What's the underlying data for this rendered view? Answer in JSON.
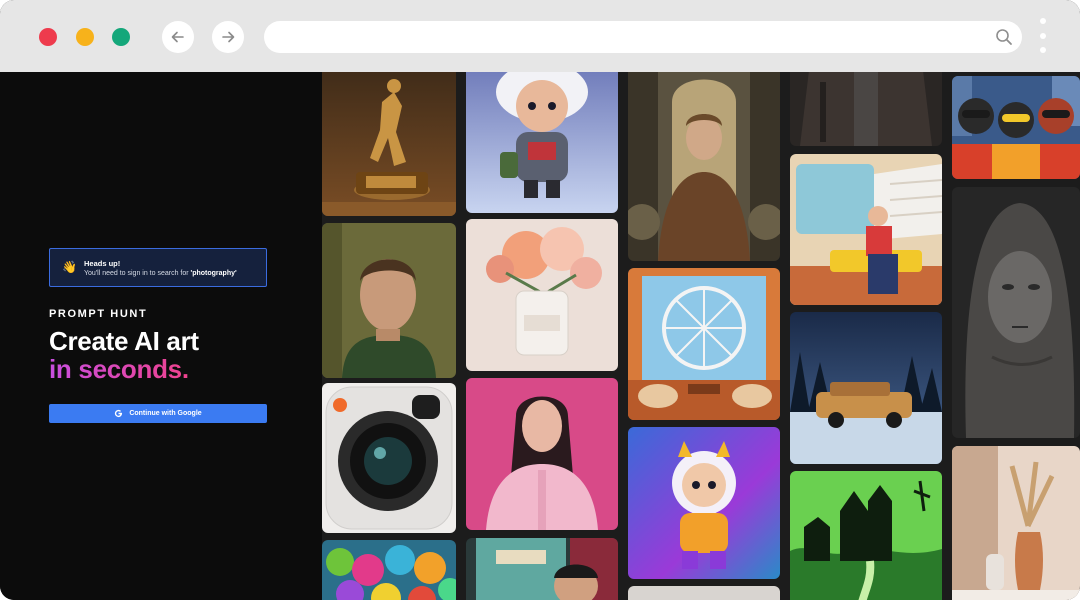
{
  "browser": {
    "url": "",
    "url_placeholder": ""
  },
  "alert": {
    "emoji": "👋",
    "title": "Heads up!",
    "body_prefix": "You'll need to sign in to search for ",
    "body_term": "'photography'"
  },
  "hero": {
    "brand": "PROMPT HUNT",
    "headline_line1": "Create AI art",
    "headline_line2": "in seconds."
  },
  "auth": {
    "google_label": "Continue with Google"
  },
  "colors": {
    "chrome": "#e6e6e6",
    "panel_bg": "#0c0c0c",
    "accent_blue": "#3b7bf2",
    "gradient_start": "#c84fe0",
    "gradient_end": "#f0428d",
    "dot_red": "#ee3b4d",
    "dot_yellow": "#f7b21b",
    "dot_green": "#14a77a"
  },
  "gallery": {
    "icons": [
      "basketball-trophy-image",
      "astronaut-toy-image",
      "aviator-woman-image",
      "leather-man-image",
      "city-dogs-image",
      "portrait-man-image",
      "peony-vase-image",
      "ferris-wheel-room-image",
      "reading-man-image",
      "stone-face-image",
      "camera-icon-image",
      "pink-woman-image",
      "cosmic-kid-image",
      "snowy-car-image",
      "haunted-house-image",
      "monsters-image",
      "retro-diner-image",
      "pampas-vase-image"
    ]
  }
}
